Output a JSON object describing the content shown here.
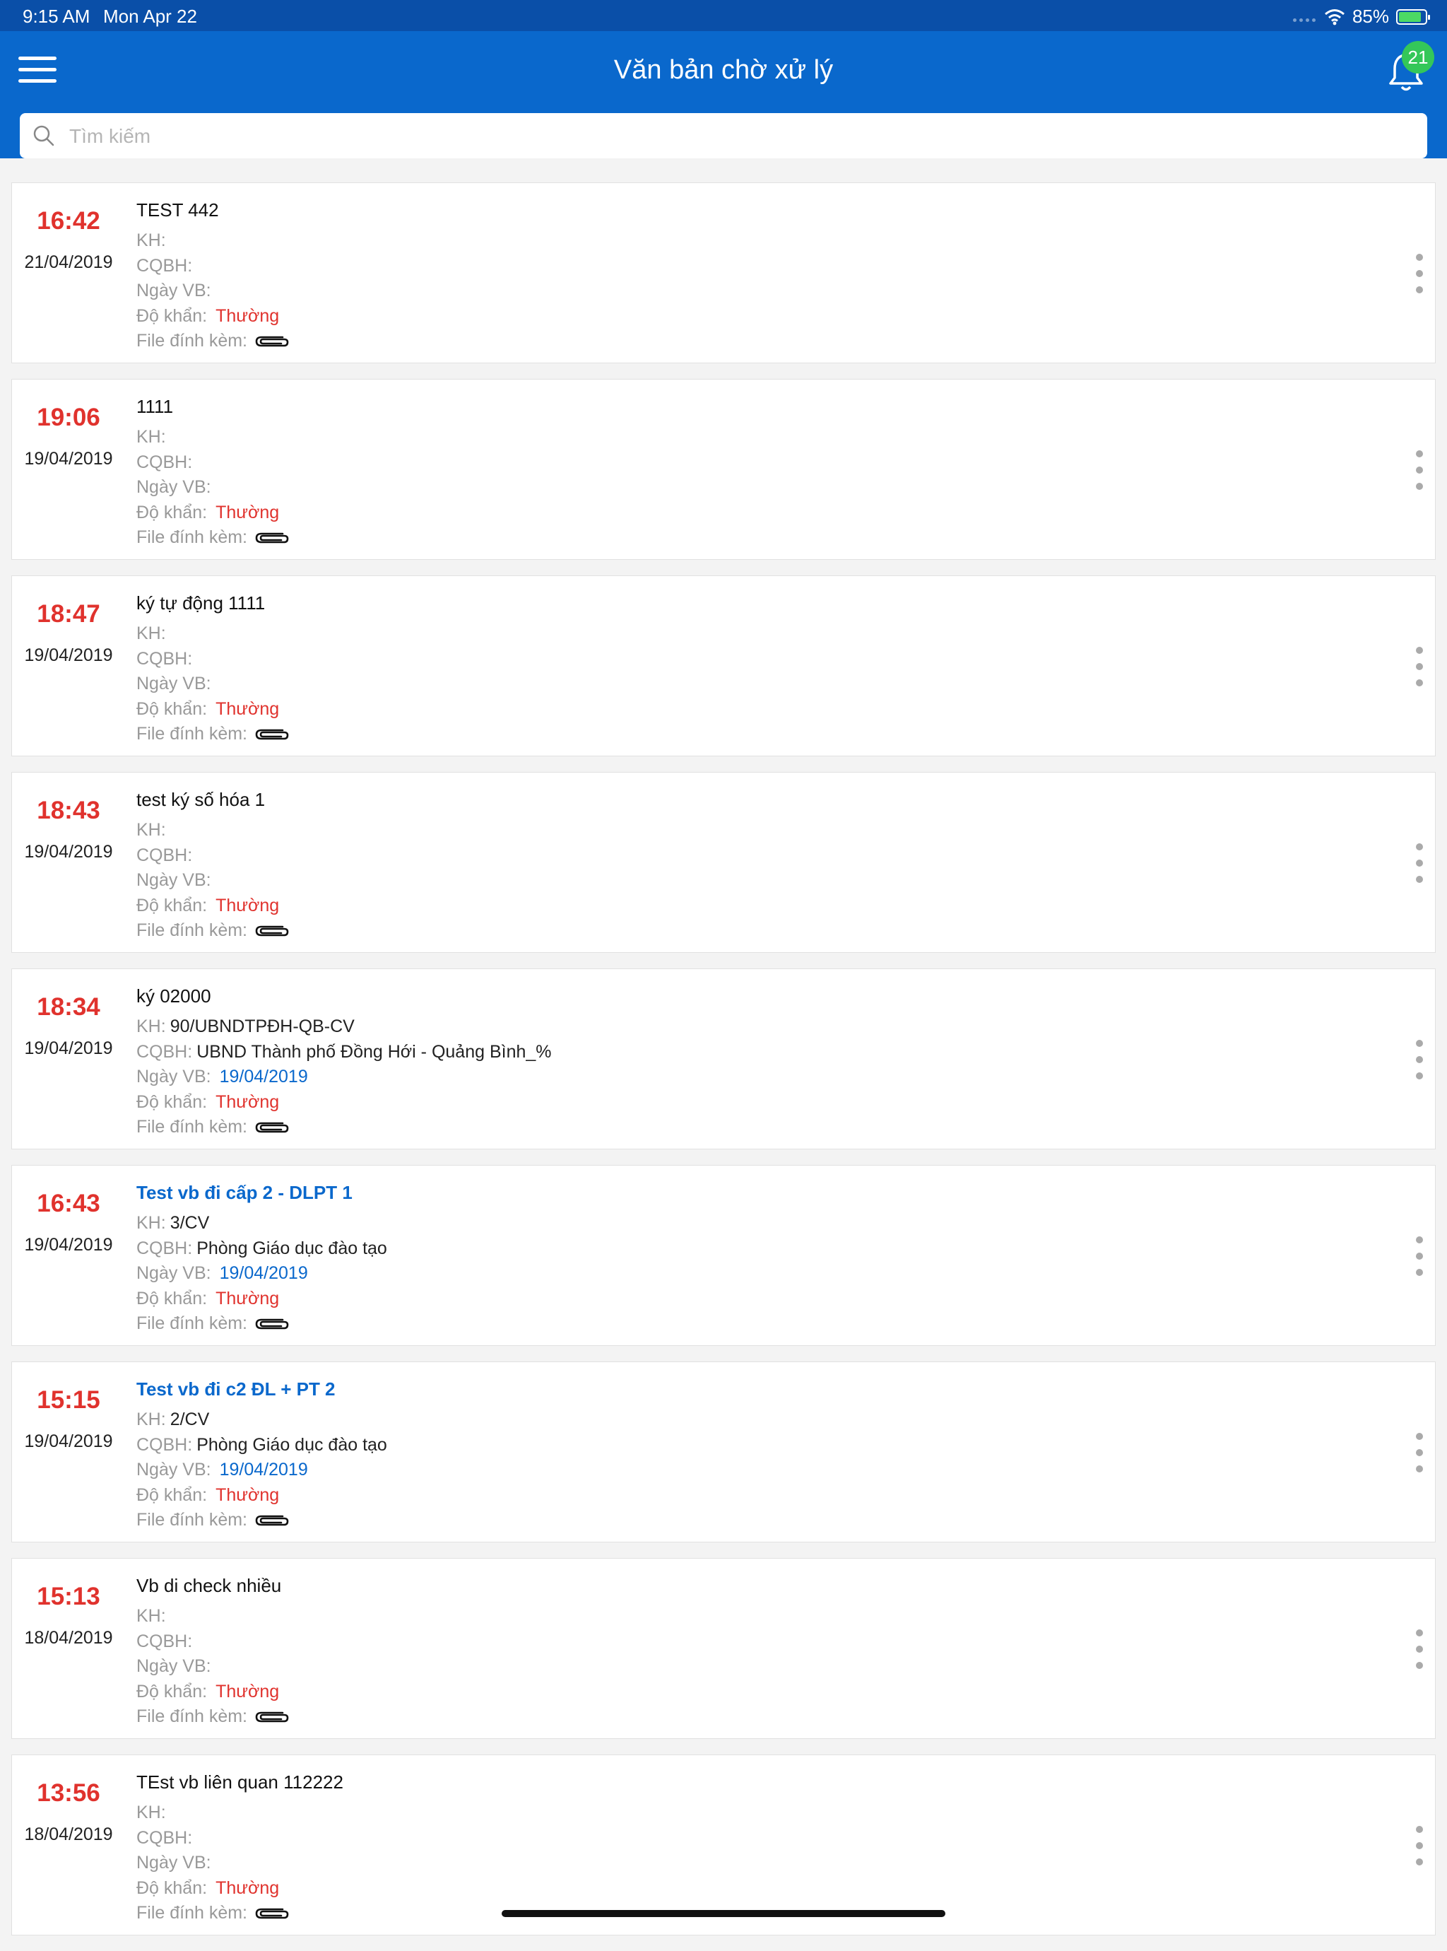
{
  "status_bar": {
    "time": "9:15 AM",
    "date": "Mon Apr 22",
    "battery": "85%",
    "battery_level": 0.85
  },
  "header": {
    "title": "Văn bản chờ xử lý",
    "notification_count": "21"
  },
  "search": {
    "placeholder": "Tìm kiếm",
    "value": ""
  },
  "labels": {
    "kh": "KH:",
    "cqbh": "CQBH:",
    "ngay_vb": "Ngày VB:",
    "do_khan": "Độ khẩn:",
    "file": "File đính kèm:"
  },
  "documents": [
    {
      "time": "16:42",
      "date": "21/04/2019",
      "title": "TEST 442",
      "title_style": "plain",
      "kh": "",
      "cqbh": "",
      "ngay_vb": "",
      "do_khan": "Thường"
    },
    {
      "time": "19:06",
      "date": "19/04/2019",
      "title": "1111",
      "title_style": "plain",
      "kh": "",
      "cqbh": "",
      "ngay_vb": "",
      "do_khan": "Thường"
    },
    {
      "time": "18:47",
      "date": "19/04/2019",
      "title": "ký tự động 1111",
      "title_style": "plain",
      "kh": "",
      "cqbh": "",
      "ngay_vb": "",
      "do_khan": "Thường"
    },
    {
      "time": "18:43",
      "date": "19/04/2019",
      "title": "test ký số hóa 1",
      "title_style": "plain",
      "kh": "",
      "cqbh": "",
      "ngay_vb": "",
      "do_khan": "Thường"
    },
    {
      "time": "18:34",
      "date": "19/04/2019",
      "title": "ký 02000",
      "title_style": "plain",
      "kh": "90/UBNDTPĐH-QB-CV",
      "cqbh": "UBND Thành phố Đồng Hới - Quảng Bình_%",
      "ngay_vb": "19/04/2019",
      "do_khan": "Thường"
    },
    {
      "time": "16:43",
      "date": "19/04/2019",
      "title": "Test vb đi cấp 2 - DLPT 1",
      "title_style": "link",
      "kh": "3/CV",
      "cqbh": "Phòng Giáo dục đào tạo",
      "ngay_vb": "19/04/2019",
      "do_khan": "Thường"
    },
    {
      "time": "15:15",
      "date": "19/04/2019",
      "title": "Test vb đi c2 ĐL + PT 2",
      "title_style": "link",
      "kh": "2/CV",
      "cqbh": "Phòng Giáo dục đào tạo",
      "ngay_vb": "19/04/2019",
      "do_khan": "Thường"
    },
    {
      "time": "15:13",
      "date": "18/04/2019",
      "title": "Vb di check nhiều",
      "title_style": "plain",
      "kh": "",
      "cqbh": "",
      "ngay_vb": "",
      "do_khan": "Thường"
    },
    {
      "time": "13:56",
      "date": "18/04/2019",
      "title": "TEst vb liên quan 112222",
      "title_style": "plain",
      "kh": "",
      "cqbh": "",
      "ngay_vb": "",
      "do_khan": "Thường"
    }
  ],
  "colors": {
    "header_bg": "#0a68cc",
    "status_bar_bg": "#0a4fa8",
    "time_red": "#e0322d",
    "link_blue": "#0a68cc",
    "badge_green": "#34c759"
  },
  "icons": {
    "menu": "hamburger-icon",
    "bell": "bell-icon",
    "search": "search-icon",
    "attachment": "paperclip-icon",
    "more": "vertical-dots-icon"
  }
}
